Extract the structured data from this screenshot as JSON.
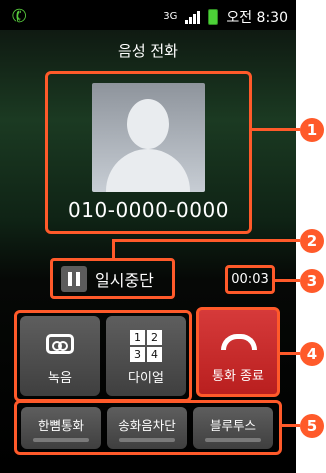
{
  "status_bar": {
    "network": "3G",
    "time": "오전 8:30"
  },
  "screen": {
    "title": "음성 전화",
    "phone_number": "010-0000-0000",
    "hold_label": "일시중단",
    "timer": "00:03"
  },
  "actions": {
    "record": "녹음",
    "dialpad": "다이얼",
    "dial_keys": [
      "1",
      "2",
      "3",
      "4"
    ],
    "end_call": "통화 종료",
    "speaker": "한뼘통화",
    "mute": "송화음차단",
    "bluetooth": "블루투스"
  },
  "callouts": [
    "1",
    "2",
    "3",
    "4",
    "5"
  ],
  "colors": {
    "accent": "#ff5a2a",
    "end_call": "#c62828",
    "battery": "#4cd137"
  }
}
